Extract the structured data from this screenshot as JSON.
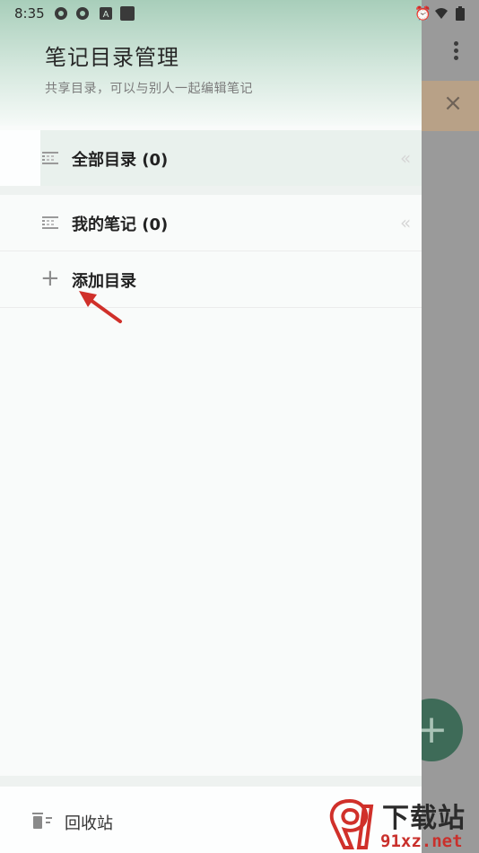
{
  "status_bar": {
    "time": "8:35"
  },
  "drawer": {
    "title": "笔记目录管理",
    "subtitle": "共享目录，可以与别人一起编辑笔记",
    "items": [
      {
        "label": "全部目录 (0)",
        "icon": "list-icon",
        "selected": true
      },
      {
        "label": "我的笔记 (0)",
        "icon": "list-icon",
        "selected": false
      }
    ],
    "add_label": "添加目录",
    "trash_label": "回收站"
  },
  "background": {
    "banner_close_icon": "close-icon",
    "menu_icon": "more-vert-icon",
    "fab_icon": "plus-icon"
  },
  "watermark": {
    "top": "下载站",
    "bottom": "91xz.net"
  },
  "colors": {
    "accent": "#a8ceba",
    "selected_row": "#e9f1ed",
    "fab": "#3e6b58",
    "arrow": "#d0302a"
  }
}
